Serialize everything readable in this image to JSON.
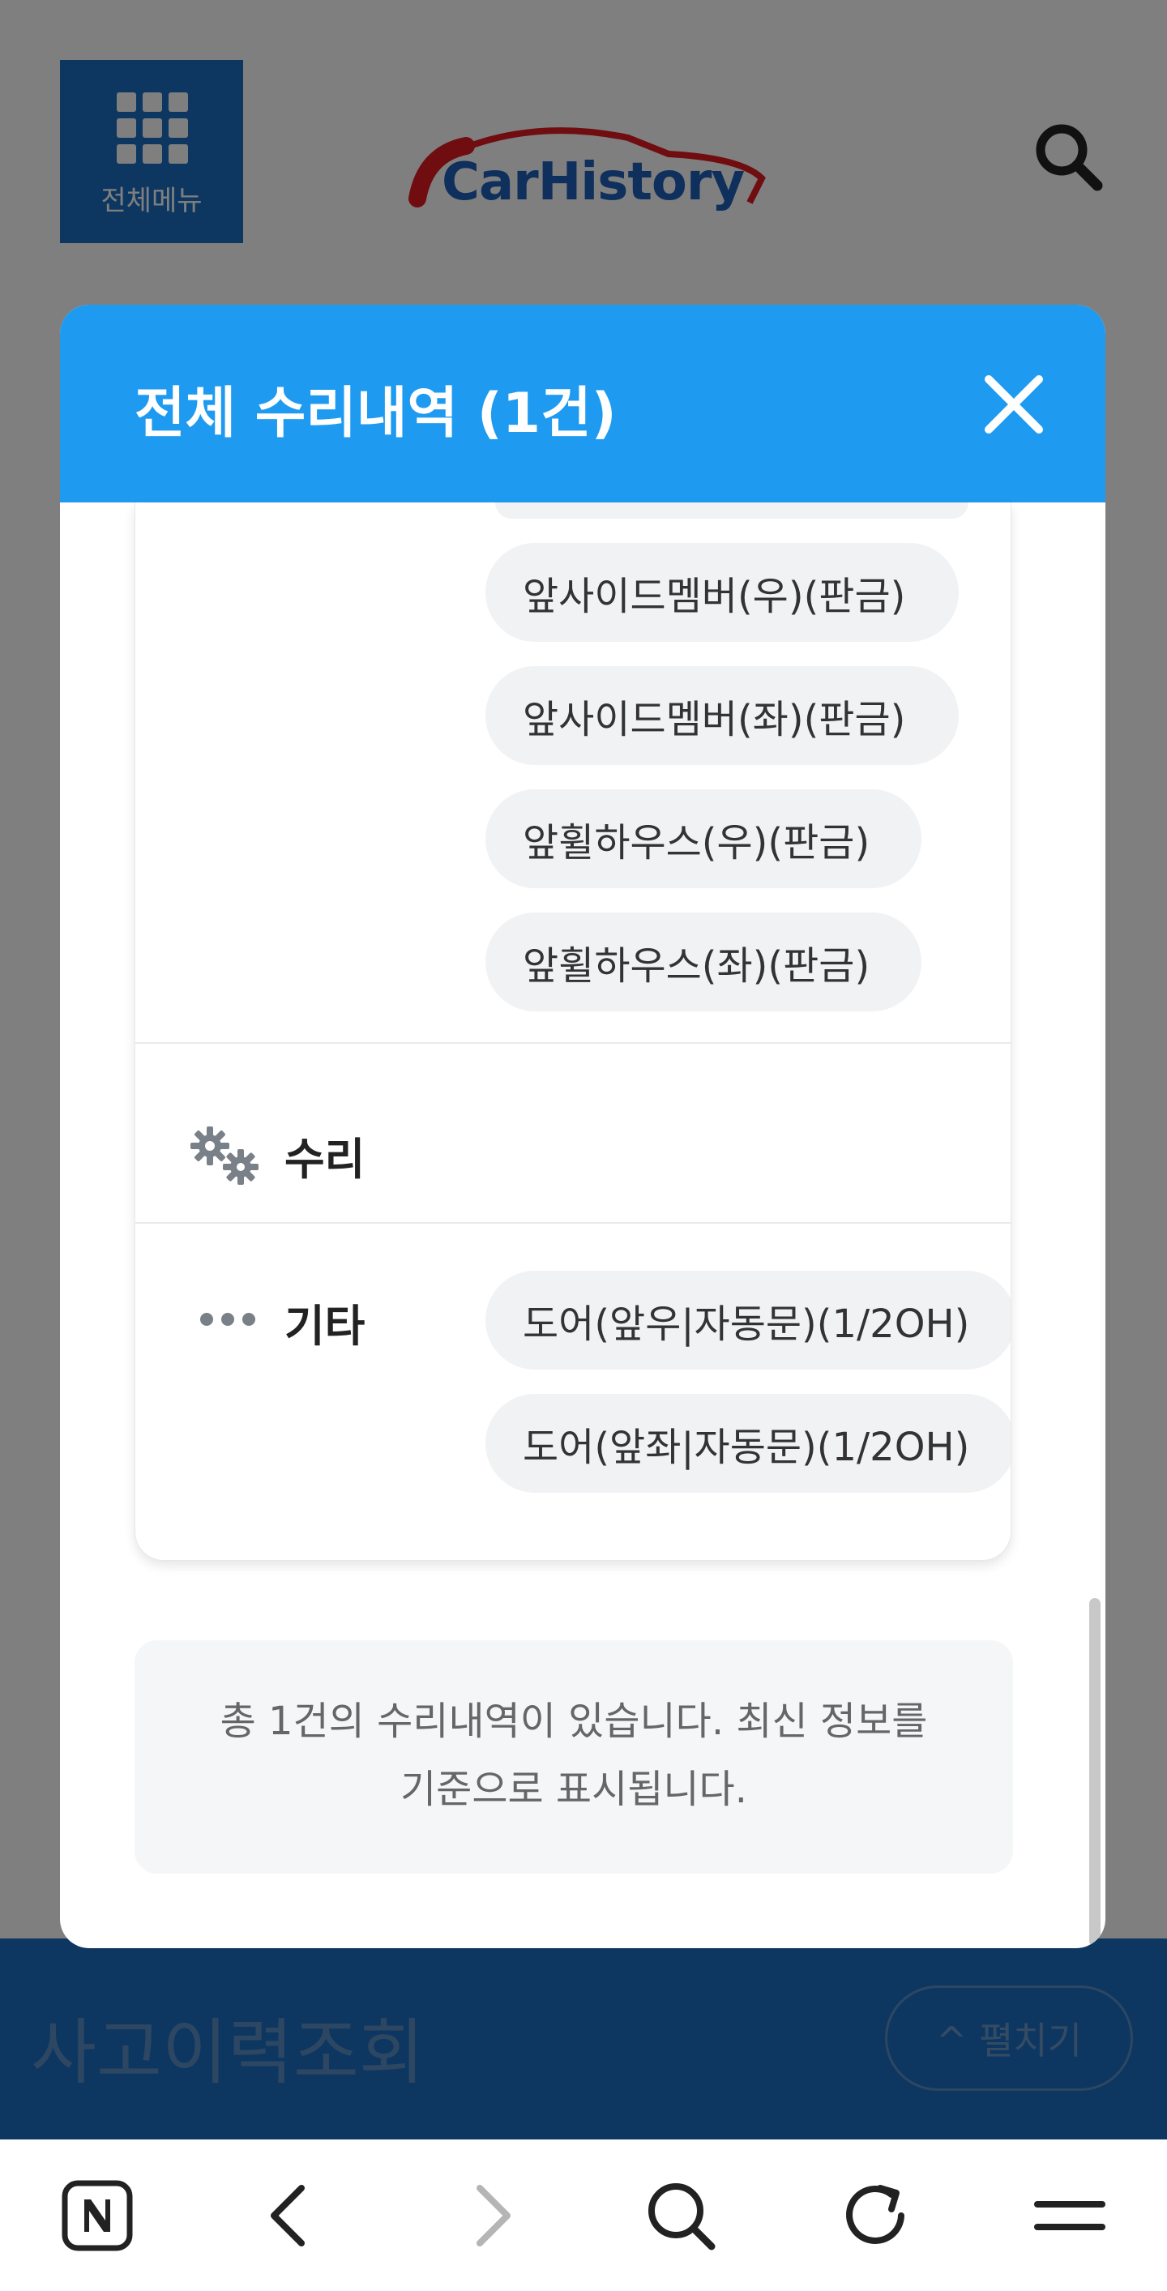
{
  "header": {
    "menu_label": "전체메뉴",
    "logo_text": "CarHistory"
  },
  "bottom_bar": {
    "title": "사고이력조회",
    "expand_label": "^ 펼치기"
  },
  "modal": {
    "title": "전체 수리내역 (1건)",
    "panel_chips": [
      "앞사이드멤버(우)(판금)",
      "앞사이드멤버(좌)(판금)",
      "앞휠하우스(우)(판금)",
      "앞휠하우스(좌)(판금)"
    ],
    "repair_category": {
      "label": "수리",
      "icon": "gears-icon"
    },
    "other_category": {
      "label": "기타",
      "icon": "more-dots-icon",
      "chips": [
        "도어(앞우|자동문)(1/2OH)",
        "도어(앞좌|자동문)(1/2OH)"
      ]
    },
    "info_line1": "총 1건의 수리내역이 있습니다. 최신 정보를",
    "info_line2": "기준으로 표시됩니다."
  },
  "browser_nav": {
    "icons": [
      "naver-home-icon",
      "back-icon",
      "forward-icon",
      "search-icon",
      "reload-icon",
      "menu-icon"
    ]
  },
  "colors": {
    "modal_header": "#1e9bf0",
    "brand_blue": "#1a6fc2",
    "chip_bg": "#f1f2f4"
  }
}
